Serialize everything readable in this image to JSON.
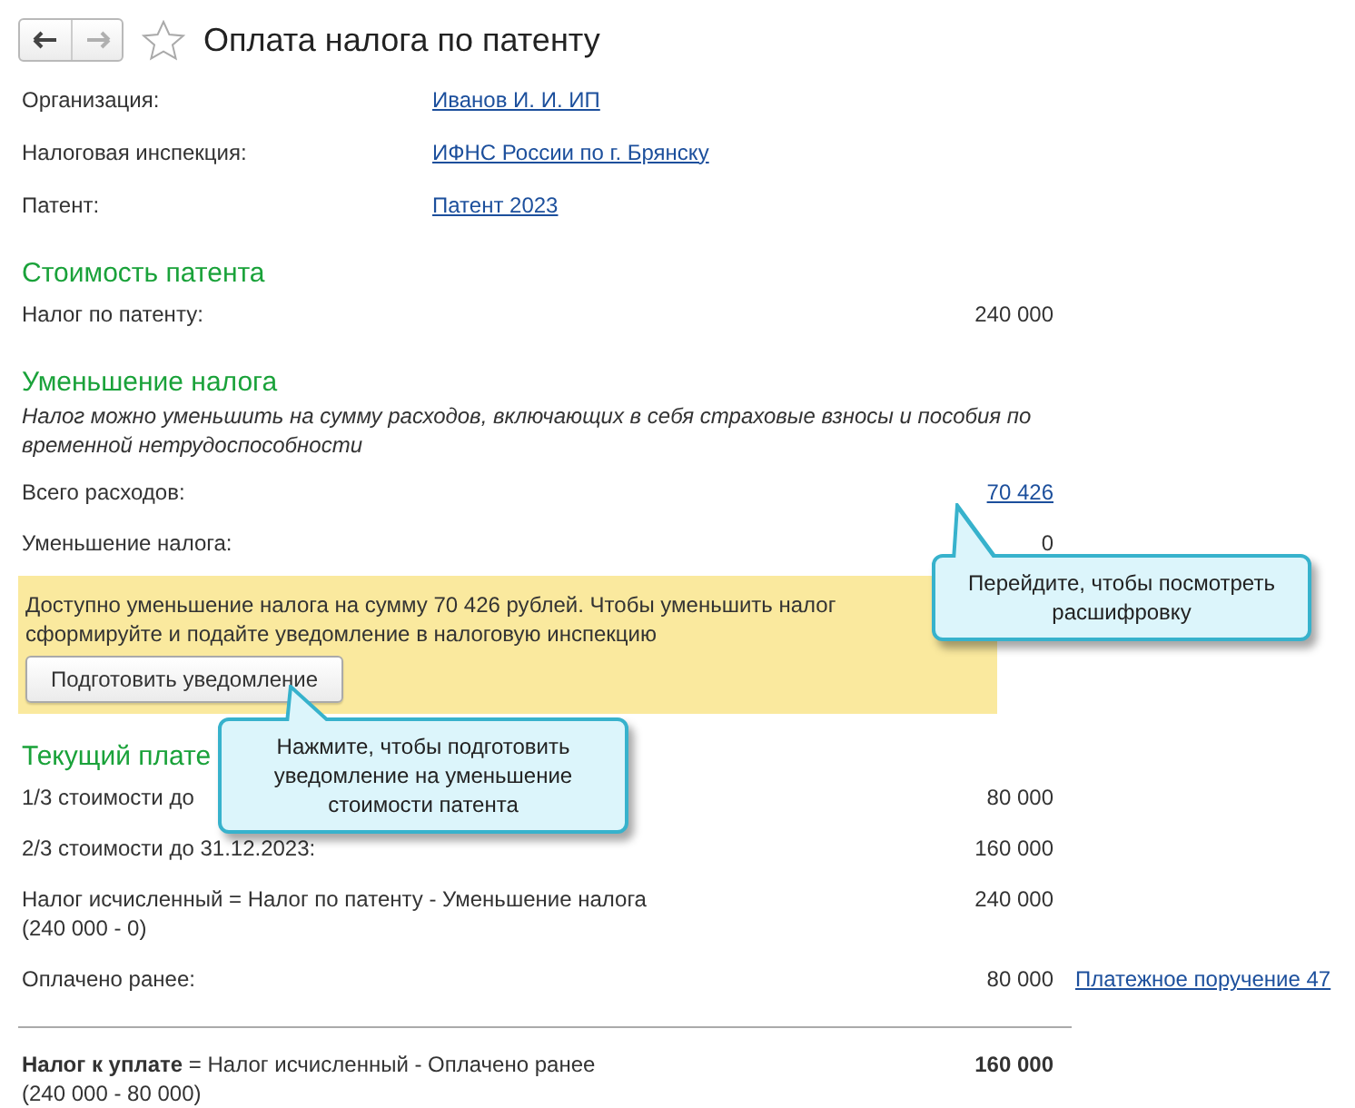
{
  "window": {
    "title": "Оплата налога по патенту"
  },
  "nav": {
    "back_disabled": false,
    "forward_disabled": true
  },
  "favorite": false,
  "header_fields": [
    {
      "label": "Организация:",
      "value": "Иванов И. И. ИП"
    },
    {
      "label": "Налоговая инспекция:",
      "value": "ИФНС России по г. Брянску"
    },
    {
      "label": "Патент:",
      "value": "Патент 2023"
    }
  ],
  "sections": [
    {
      "title": "Стоимость патента",
      "items": [
        {
          "kind": "amount",
          "label": "Налог по патенту:",
          "value": "240 000"
        }
      ]
    },
    {
      "title": "Уменьшение налога",
      "items": [
        {
          "kind": "note",
          "text": "Налог можно уменьшить на сумму расходов, включающих в себя страховые взносы и пособия по временной нетрудоспособности"
        },
        {
          "kind": "link_amount",
          "label": "Всего расходов:",
          "value": "70 426"
        },
        {
          "kind": "amount",
          "label": "Уменьшение налога:",
          "value": "0"
        },
        {
          "kind": "notice",
          "text": "Доступно уменьшение налога на сумму 70 426 рублей. Чтобы уменьшить налог сформируйте и подайте уведомление в налоговую инспекцию",
          "button": "Подготовить уведомление"
        }
      ]
    },
    {
      "title": "Текущий плате",
      "items": [
        {
          "kind": "amount",
          "label": "1/3 стоимости до",
          "value": "80 000"
        },
        {
          "kind": "amount",
          "label": "2/3 стоимости до 31.12.2023:",
          "value": "160 000"
        },
        {
          "kind": "amount",
          "label": "Налог исчисленный = Налог по патенту - Уменьшение налога",
          "sublabel": "(240 000 - 0)",
          "value": "240 000"
        },
        {
          "kind": "amount",
          "label": "Оплачено ранее:",
          "value": "80 000",
          "link": "Платежное поручение 47"
        }
      ]
    }
  ],
  "total": {
    "label": "**Налог к уплате** = Налог исчисленный - Оплачено ранее",
    "sublabel": "(240 000 - 80 000)",
    "value": "160 000"
  },
  "callouts": [
    {
      "text": "Перейдите, чтобы посмотреть расшифровку"
    },
    {
      "text": "Нажмите, чтобы подготовить уведомление на уменьшение стоимости патента"
    }
  ]
}
